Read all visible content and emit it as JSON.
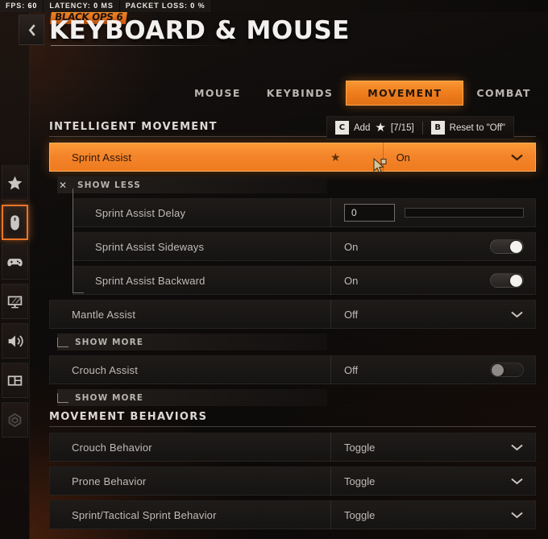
{
  "status_bar": {
    "fps_label": "FPS:",
    "fps_value": "60",
    "latency_label": "LATENCY:",
    "latency_value": "0",
    "latency_unit": "MS",
    "packet_loss_label": "PACKET LOSS:",
    "packet_loss_value": "0",
    "packet_loss_unit": "%"
  },
  "header": {
    "back_icon": "chevron-left-icon",
    "game_logo": "BLACK OPS 6",
    "page_title": "KEYBOARD & MOUSE"
  },
  "tabs": [
    {
      "label": "MOUSE",
      "active": false
    },
    {
      "label": "KEYBINDS",
      "active": false
    },
    {
      "label": "MOVEMENT",
      "active": true
    },
    {
      "label": "COMBAT",
      "active": false
    }
  ],
  "hints": [
    {
      "key": "C",
      "label": "Add",
      "star": "★",
      "count": "[7/15]"
    },
    {
      "key": "B",
      "label": "Reset to \"Off\""
    }
  ],
  "sidebar": {
    "items": [
      {
        "icon": "star-icon",
        "active": false,
        "dim": false
      },
      {
        "icon": "mouse-icon",
        "active": true,
        "dim": false
      },
      {
        "icon": "gamepad-icon",
        "active": false,
        "dim": false
      },
      {
        "icon": "monitor-graphics-icon",
        "active": false,
        "dim": false
      },
      {
        "icon": "speaker-audio-icon",
        "active": false,
        "dim": false
      },
      {
        "icon": "interface-layout-icon",
        "active": false,
        "dim": false
      },
      {
        "icon": "telemetry-radar-icon",
        "active": false,
        "dim": true
      }
    ]
  },
  "sections": [
    {
      "title": "INTELLIGENT MOVEMENT",
      "rows": [
        {
          "label": "Sprint Assist",
          "value": "On",
          "control": "chevron",
          "highlight": true,
          "starred": true,
          "sub": false
        },
        {
          "label": "SHOW LESS",
          "kind": "show-toggle",
          "icon": "close-x-icon"
        },
        {
          "label": "Sprint Assist Delay",
          "value": "0",
          "control": "slider",
          "sub": true
        },
        {
          "label": "Sprint Assist Sideways",
          "value": "On",
          "control": "toggle-on",
          "sub": true
        },
        {
          "label": "Sprint Assist Backward",
          "value": "On",
          "control": "toggle-on",
          "sub": true
        },
        {
          "label": "Mantle Assist",
          "value": "Off",
          "control": "chevron",
          "sub": false
        },
        {
          "label": "SHOW MORE",
          "kind": "show-toggle",
          "icon": "corner-branch-icon"
        },
        {
          "label": "Crouch Assist",
          "value": "Off",
          "control": "toggle-off",
          "sub": false
        },
        {
          "label": "SHOW MORE",
          "kind": "show-toggle",
          "icon": "corner-branch-icon"
        }
      ]
    },
    {
      "title": "MOVEMENT BEHAVIORS",
      "rows": [
        {
          "label": "Crouch Behavior",
          "value": "Toggle",
          "control": "chevron",
          "sub": false
        },
        {
          "label": "Prone Behavior",
          "value": "Toggle",
          "control": "chevron",
          "sub": false
        },
        {
          "label": "Sprint/Tactical Sprint Behavior",
          "value": "Toggle",
          "control": "chevron",
          "sub": false
        }
      ]
    }
  ],
  "colors": {
    "accent": "#ef7c1b",
    "highlight_row": "#f4842a",
    "background": "#0a0807",
    "text_primary": "#bfbbb7"
  },
  "cursor": {
    "icon": "pointer-cursor"
  }
}
